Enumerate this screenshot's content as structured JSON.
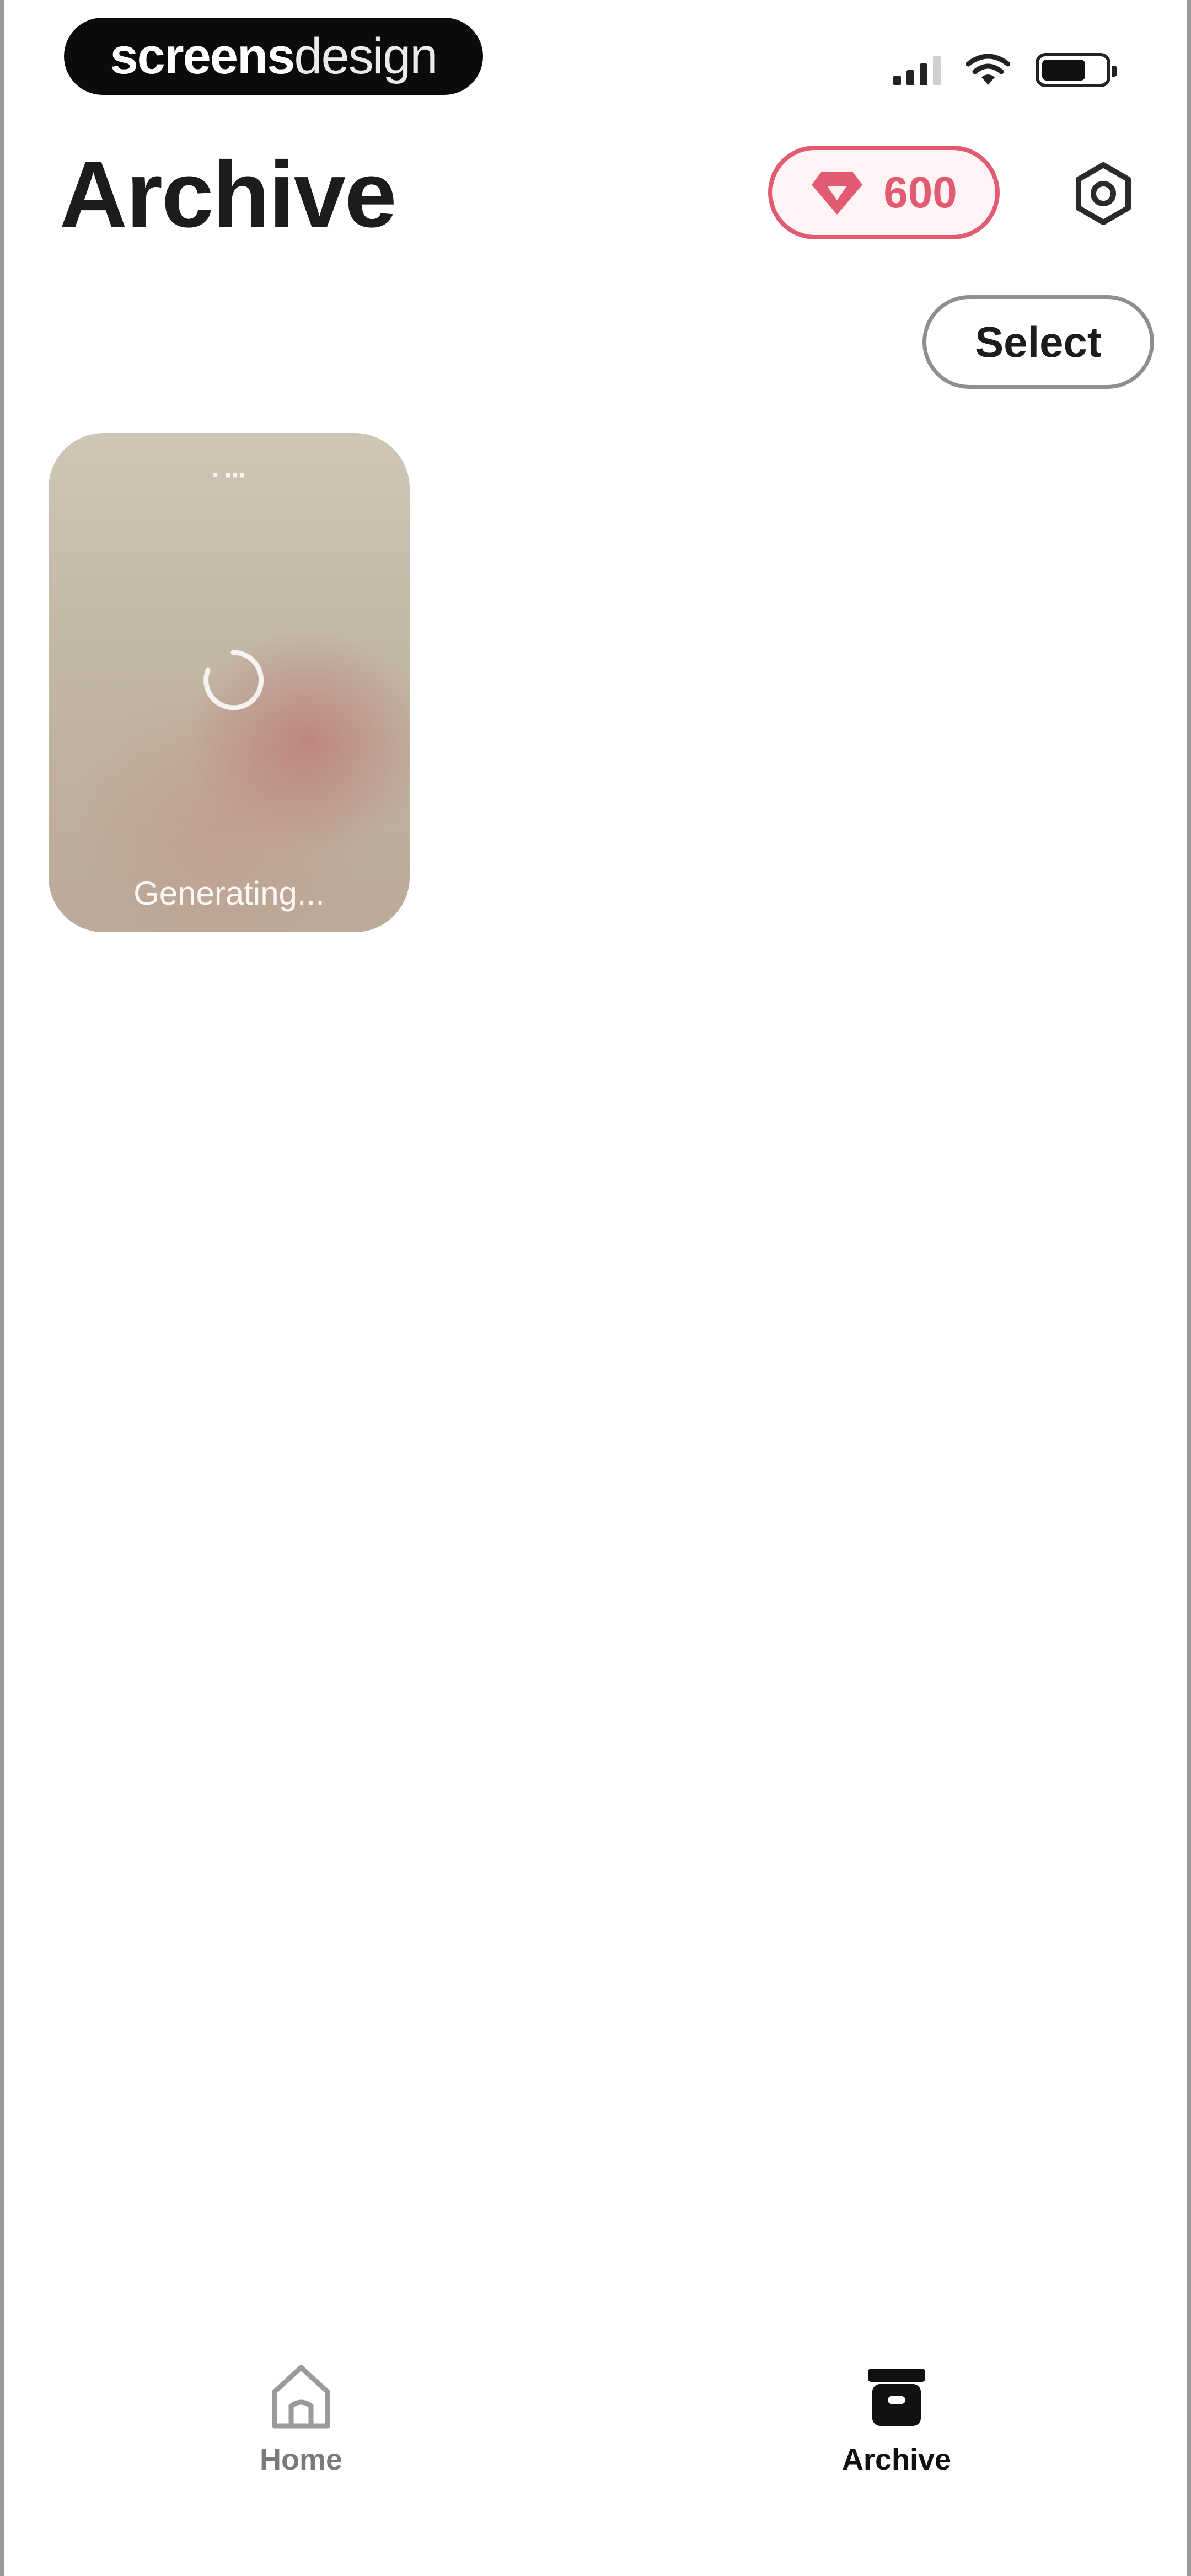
{
  "status_bar": {
    "brand": {
      "part1": "screens",
      "part2": "design"
    },
    "icons": [
      "signal-icon",
      "wifi-icon",
      "battery-icon"
    ]
  },
  "header": {
    "title": "Archive",
    "credits": {
      "value": "600",
      "icon": "gem-icon",
      "color": "#e25b73"
    },
    "settings_icon": "gear-icon"
  },
  "toolbar": {
    "select_label": "Select"
  },
  "archive_items": [
    {
      "status_text": "• ▪▪▪",
      "label": "Generating...",
      "icon": "spinner-icon"
    }
  ],
  "tabbar": {
    "tabs": [
      {
        "label": "Home",
        "icon": "home-icon",
        "active": false
      },
      {
        "label": "Archive",
        "icon": "archive-icon",
        "active": true
      }
    ]
  },
  "colors": {
    "accent": "#e25b73",
    "text": "#1c1c1c",
    "muted": "#7a7a7a"
  }
}
